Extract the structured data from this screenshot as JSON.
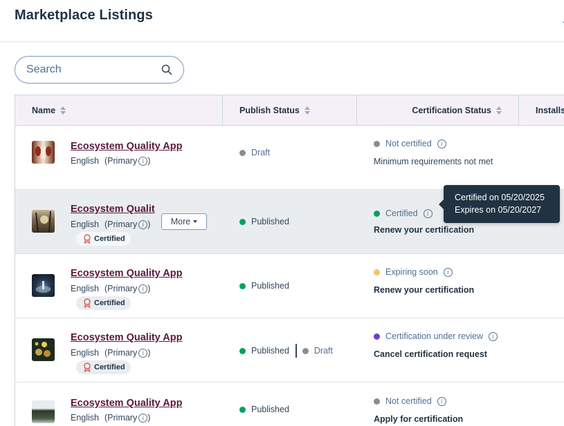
{
  "header": {
    "title": "Marketplace Listings",
    "corner_mark": "."
  },
  "search": {
    "placeholder": "Search",
    "value": ""
  },
  "columns": {
    "name": "Name",
    "publish_status": "Publish Status",
    "certification_status": "Certification Status",
    "installs": "Installs"
  },
  "rows": [
    {
      "name": "Ecosystem Quality App",
      "language": "English",
      "primary": "(Primary",
      "badge": "",
      "publish": [
        "Draft"
      ],
      "cert_status": "Not certified",
      "cert_action": "Minimum requirements not met"
    },
    {
      "name": "Ecosystem Qualit",
      "language": "English",
      "primary": "(Primary",
      "badge": "Certified",
      "more": "More",
      "publish": [
        "Published"
      ],
      "cert_status": "Certified",
      "cert_action": "Renew your certification"
    },
    {
      "name": "Ecosystem Quality App",
      "language": "English",
      "primary": "(Primary",
      "badge": "Certified",
      "publish": [
        "Published"
      ],
      "cert_status": "Expiring soon",
      "cert_action": "Renew your certification"
    },
    {
      "name": "Ecosystem Quality App",
      "language": "English",
      "primary": "(Primary",
      "badge": "Certified",
      "publish": [
        "Published",
        "Draft"
      ],
      "cert_status": "Certification under review",
      "cert_action": "Cancel certification request"
    },
    {
      "name": "Ecosystem Quality App",
      "language": "English",
      "primary": "(Primary",
      "badge": "",
      "publish": [
        "Published"
      ],
      "cert_status": "Not certified",
      "cert_action": "Apply for certification"
    }
  ],
  "tooltip": {
    "line1": "Certified on 05/20/2025",
    "line2": "Expires on 05/20/2027"
  },
  "colors": {
    "published": "#00a35c",
    "draft": "#8c8c8c",
    "not_certified": "#8c8c8c",
    "certified": "#00a35c",
    "expiring_soon": "#f5c26b",
    "under_review": "#6a3fd1",
    "link": "#5a1a3c",
    "header_bg": "#f5f0f7",
    "badge_icon": "#e0574c"
  },
  "icons": {
    "search": "search-icon",
    "info": "info-icon",
    "sort": "sort-icon",
    "badge": "ribbon-icon",
    "caret": "caret-down-icon"
  }
}
